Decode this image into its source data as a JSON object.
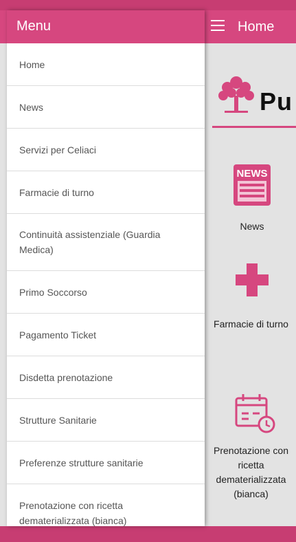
{
  "drawer": {
    "title": "Menu",
    "items": [
      {
        "label": "Home"
      },
      {
        "label": "News"
      },
      {
        "label": "Servizi per Celiaci"
      },
      {
        "label": "Farmacie di turno"
      },
      {
        "label": "Continuità assistenziale (Guardia Medica)"
      },
      {
        "label": "Primo Soccorso"
      },
      {
        "label": "Pagamento Ticket"
      },
      {
        "label": "Disdetta prenotazione"
      },
      {
        "label": "Strutture Sanitarie"
      },
      {
        "label": "Preferenze strutture sanitarie"
      },
      {
        "label": "Prenotazione con ricetta dematerializzata (bianca)"
      }
    ]
  },
  "app": {
    "title": "Home",
    "logo_text": "Pu",
    "tiles": [
      {
        "label": "News",
        "icon": "newspaper-icon",
        "icon_text": "NEWS"
      },
      {
        "label": "Farmacie di turno",
        "icon": "pharmacy-cross-icon"
      },
      {
        "label": "Prenotazione con ricetta dematerializzata (bianca)",
        "icon": "calendar-clock-icon"
      }
    ]
  },
  "colors": {
    "accent": "#d6477f",
    "accent_dark": "#c73d72",
    "background": "#e3e3e3"
  }
}
